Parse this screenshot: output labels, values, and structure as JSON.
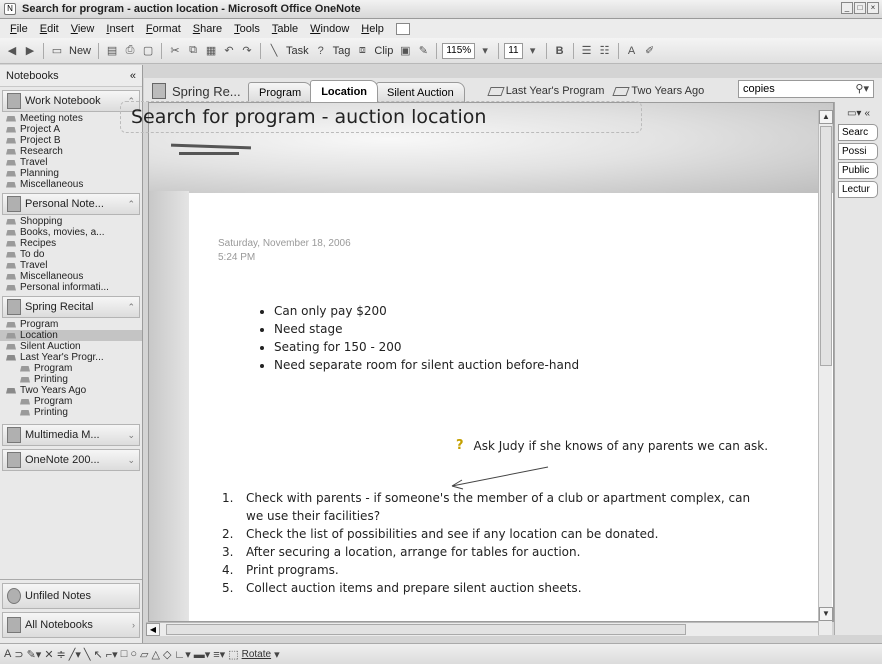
{
  "window": {
    "title": "Search for program - auction location - Microsoft Office OneNote"
  },
  "menu": [
    "File",
    "Edit",
    "View",
    "Insert",
    "Format",
    "Share",
    "Tools",
    "Table",
    "Window",
    "Help"
  ],
  "toolbar": {
    "new_label": "New",
    "task_label": "Task",
    "tag_label": "Tag",
    "clip_label": "Clip",
    "zoom": "115%",
    "font_size": "11"
  },
  "nav": {
    "header": "Notebooks",
    "notebooks": [
      {
        "name": "Work Notebook",
        "sections": [
          "Meeting notes",
          "Project A",
          "Project B",
          "Research",
          "Travel",
          "Planning",
          "Miscellaneous"
        ]
      },
      {
        "name": "Personal Note...",
        "sections": [
          "Shopping",
          "Books, movies, a...",
          "Recipes",
          "To do",
          "Travel",
          "Miscellaneous",
          "Personal informati..."
        ]
      },
      {
        "name": "Spring Recital"
      },
      {
        "name": "Multimedia M..."
      },
      {
        "name": "OneNote 200..."
      }
    ],
    "spring": {
      "program": "Program",
      "location": "Location",
      "silent": "Silent Auction",
      "last_year": "Last Year's Progr...",
      "last_program": "Program",
      "last_printing": "Printing",
      "two_years": "Two Years Ago",
      "two_program": "Program",
      "two_printing": "Printing"
    },
    "unfiled": "Unfiled Notes",
    "all": "All Notebooks"
  },
  "tabs": {
    "notebook": "Spring Re...",
    "items": [
      "Program",
      "Location",
      "Silent Auction"
    ],
    "groups": [
      "Last Year's Program",
      "Two Years Ago"
    ],
    "search_value": "copies"
  },
  "page": {
    "title": "Search for program - auction location",
    "date": "Saturday, November 18, 2006",
    "time": "5:24 PM",
    "bullets": [
      "Can only pay $200",
      "Need stage",
      "Seating for 150 - 200",
      "Need separate room for silent auction before-hand"
    ],
    "note": "Ask Judy if she knows of any parents we can ask.",
    "steps": [
      "Check with parents - if someone's the member of a club or apartment complex, can",
      "we use their facilities?",
      "Check the list of possibilities and see if any location can be donated.",
      "After securing a location, arrange for tables for auction.",
      "Print programs.",
      "Collect auction items and prepare silent auction sheets."
    ],
    "step_numbers": [
      "1.",
      "2.",
      "3.",
      "4.",
      "5."
    ]
  },
  "pagelist": [
    "Searc",
    "Possi",
    "Public",
    "Lectur"
  ],
  "drawbar": {
    "rotate": "Rotate"
  }
}
